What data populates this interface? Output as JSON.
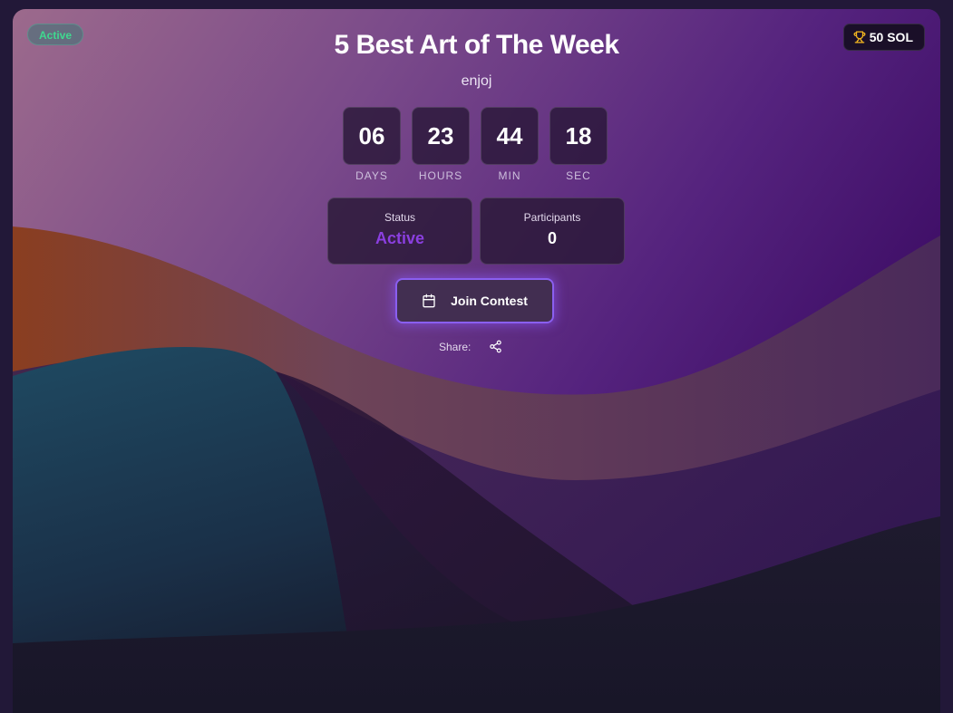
{
  "contest": {
    "badge": "Active",
    "prize": "50 SOL",
    "title": "5 Best Art of The Week",
    "subtitle": "enjoj"
  },
  "countdown": [
    {
      "value": "06",
      "label": "DAYS"
    },
    {
      "value": "23",
      "label": "HOURS"
    },
    {
      "value": "44",
      "label": "MIN"
    },
    {
      "value": "18",
      "label": "SEC"
    }
  ],
  "stats": {
    "status_label": "Status",
    "status_value": "Active",
    "participants_label": "Participants",
    "participants_value": "0"
  },
  "actions": {
    "join_label": "Join Contest",
    "share_label": "Share:"
  },
  "icons": {
    "prize": "trophy-icon",
    "join": "calendar-icon",
    "share": "share-icon"
  },
  "colors": {
    "active_badge": "#3fd98f",
    "status_value": "#8b3fe0",
    "trophy": "#f5b820",
    "button_glow": "#8a5ff0"
  }
}
